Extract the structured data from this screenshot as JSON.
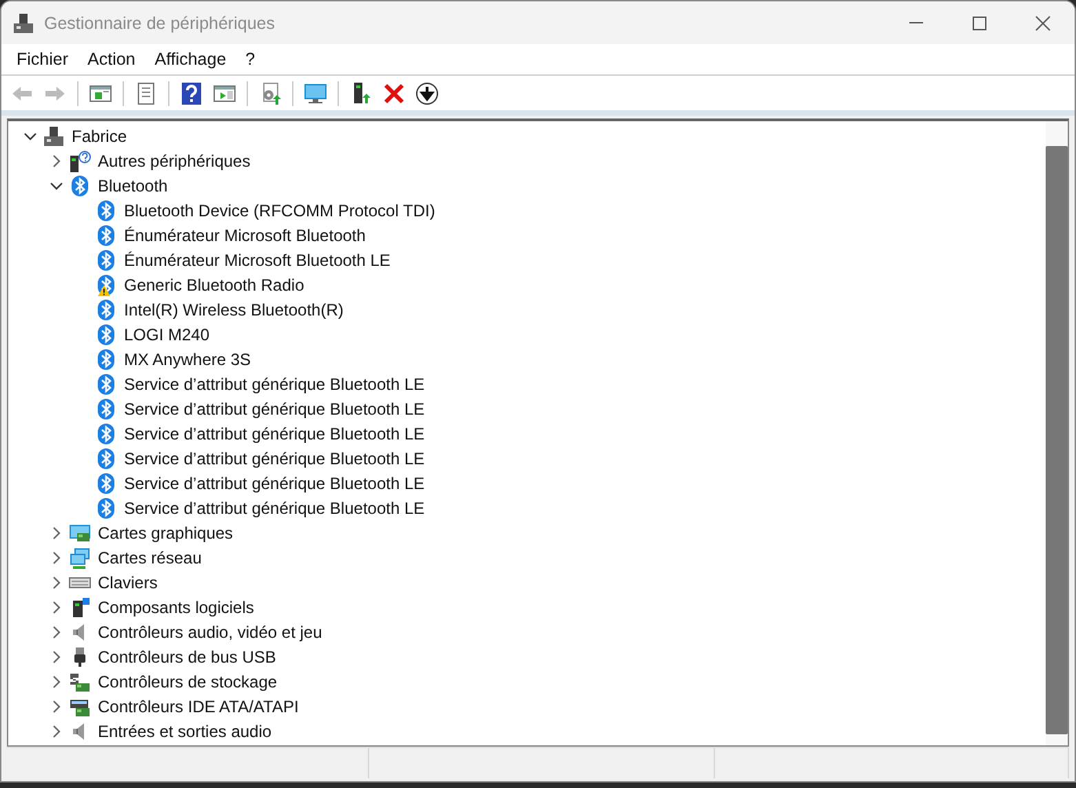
{
  "window": {
    "title": "Gestionnaire de périphériques"
  },
  "menu": [
    "Fichier",
    "Action",
    "Affichage",
    "?"
  ],
  "toolbar": [
    {
      "kind": "back",
      "disabled": true
    },
    {
      "kind": "forward",
      "disabled": true
    },
    {
      "kind": "separator"
    },
    {
      "kind": "console-tree"
    },
    {
      "kind": "separator"
    },
    {
      "kind": "properties"
    },
    {
      "kind": "separator"
    },
    {
      "kind": "help"
    },
    {
      "kind": "action-pane"
    },
    {
      "kind": "separator"
    },
    {
      "kind": "scan"
    },
    {
      "kind": "separator"
    },
    {
      "kind": "monitor"
    },
    {
      "kind": "separator"
    },
    {
      "kind": "update"
    },
    {
      "kind": "uninstall"
    },
    {
      "kind": "disable"
    }
  ],
  "tree": {
    "label": "Fabrice",
    "kind": "computer",
    "expanded": true,
    "children": [
      {
        "label": "Autres périphériques",
        "kind": "unknown",
        "expanded": false
      },
      {
        "label": "Bluetooth",
        "kind": "bluetooth",
        "expanded": true,
        "children": [
          {
            "label": "Bluetooth Device (RFCOMM Protocol TDI)",
            "kind": "bluetooth",
            "warning": false
          },
          {
            "label": "Énumérateur Microsoft Bluetooth",
            "kind": "bluetooth",
            "warning": false
          },
          {
            "label": "Énumérateur Microsoft Bluetooth LE",
            "kind": "bluetooth",
            "warning": false
          },
          {
            "label": "Generic Bluetooth Radio",
            "kind": "bluetooth",
            "warning": true
          },
          {
            "label": "Intel(R) Wireless Bluetooth(R)",
            "kind": "bluetooth",
            "warning": false
          },
          {
            "label": "LOGI M240",
            "kind": "bluetooth",
            "warning": false
          },
          {
            "label": "MX Anywhere 3S",
            "kind": "bluetooth",
            "warning": false
          },
          {
            "label": "Service d’attribut générique Bluetooth LE",
            "kind": "bluetooth",
            "warning": false
          },
          {
            "label": "Service d’attribut générique Bluetooth LE",
            "kind": "bluetooth",
            "warning": false
          },
          {
            "label": "Service d’attribut générique Bluetooth LE",
            "kind": "bluetooth",
            "warning": false
          },
          {
            "label": "Service d’attribut générique Bluetooth LE",
            "kind": "bluetooth",
            "warning": false
          },
          {
            "label": "Service d’attribut générique Bluetooth LE",
            "kind": "bluetooth",
            "warning": false
          },
          {
            "label": "Service d’attribut générique Bluetooth LE",
            "kind": "bluetooth",
            "warning": false
          }
        ]
      },
      {
        "label": "Cartes graphiques",
        "kind": "display",
        "expanded": false
      },
      {
        "label": "Cartes réseau",
        "kind": "network",
        "expanded": false
      },
      {
        "label": "Claviers",
        "kind": "keyboard",
        "expanded": false
      },
      {
        "label": "Composants logiciels",
        "kind": "software",
        "expanded": false
      },
      {
        "label": "Contrôleurs audio, vidéo et jeu",
        "kind": "audio",
        "expanded": false
      },
      {
        "label": "Contrôleurs de bus USB",
        "kind": "usb",
        "expanded": false
      },
      {
        "label": "Contrôleurs de stockage",
        "kind": "storage",
        "expanded": false
      },
      {
        "label": "Contrôleurs IDE ATA/ATAPI",
        "kind": "ide",
        "expanded": false
      },
      {
        "label": "Entrées et sorties audio",
        "kind": "audio",
        "expanded": false
      }
    ]
  }
}
